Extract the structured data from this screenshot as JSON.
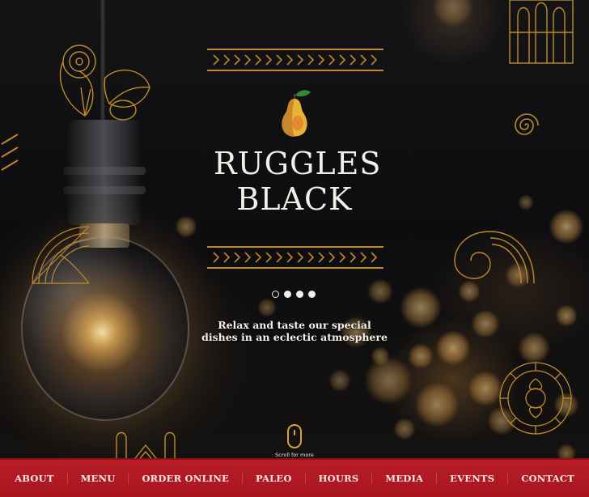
{
  "brand": {
    "name_line1": "RUGGLES",
    "name_line2": "BLACK",
    "logo_icon": "pear-icon"
  },
  "hero": {
    "tagline_line1": "Relax and taste our special",
    "tagline_line2": "dishes in an eclectic atmosphere",
    "slider": {
      "total": 4,
      "active": 1
    },
    "scroll_label": "Scroll for more",
    "scroll_icon": "mouse-scroll-icon"
  },
  "nav": {
    "items": [
      {
        "label": "ABOUT"
      },
      {
        "label": "MENU"
      },
      {
        "label": "ORDER ONLINE"
      },
      {
        "label": "PALEO"
      },
      {
        "label": "HOURS"
      },
      {
        "label": "MEDIA"
      },
      {
        "label": "EVENTS"
      },
      {
        "label": "CONTACT"
      }
    ]
  },
  "colors": {
    "accent_gold": "#c08a2c",
    "nav_red": "#b81e28",
    "text_light": "#f4efe6"
  }
}
